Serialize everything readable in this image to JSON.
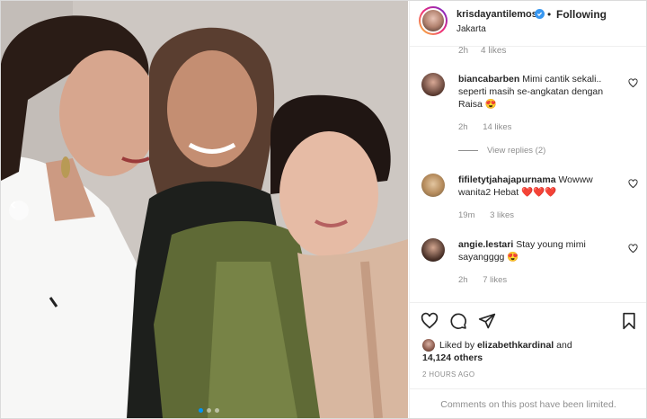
{
  "post": {
    "username": "krisdayantilemos",
    "follow_label": "Following",
    "separator": "•",
    "location": "Jakarta",
    "colors": {
      "verified": "#3897f0",
      "accent": "#0095f6",
      "muted": "#8e8e8e"
    }
  },
  "comments": {
    "top_meta": {
      "time": "2h",
      "likes": "4 likes"
    },
    "items": [
      {
        "username": "biancabarben",
        "text": "Mimi cantik sekali.. seperti masih se-angkatan dengan Raisa 😍",
        "time": "2h",
        "likes": "14 likes",
        "replies_label": "View replies (2)"
      },
      {
        "username": "fifiletytjahajapurnama",
        "text": "Wowww wanita2 Hebat ❤️❤️❤️",
        "time": "19m",
        "likes": "3 likes"
      },
      {
        "username": "angie.lestari",
        "text": "Stay young mimi sayangggg 😍",
        "time": "2h",
        "likes": "7 likes"
      }
    ]
  },
  "engagement": {
    "liked_by_prefix": "Liked by",
    "liked_by_user": "elizabethkardinal",
    "and_label": "and",
    "others": "14,124 others",
    "posted_ago": "2 HOURS AGO"
  },
  "footer": {
    "limited_text": "Comments on this post have been limited."
  },
  "carousel": {
    "dots": 3,
    "active_index": 0
  },
  "icons": [
    "verified-icon",
    "heart-icon",
    "comment-icon",
    "share-icon",
    "bookmark-icon",
    "chevron-left-icon"
  ]
}
